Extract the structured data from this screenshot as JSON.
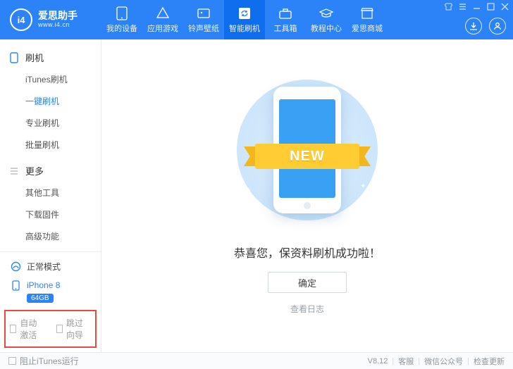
{
  "brand": {
    "mark": "i4",
    "zh": "爱思助手",
    "en": "www.i4.cn"
  },
  "nav": [
    {
      "label": "我的设备"
    },
    {
      "label": "应用游戏"
    },
    {
      "label": "铃声壁纸"
    },
    {
      "label": "智能刷机"
    },
    {
      "label": "工具箱"
    },
    {
      "label": "教程中心"
    },
    {
      "label": "爱思商城"
    }
  ],
  "sidebar": {
    "group1": {
      "title": "刷机"
    },
    "items1": [
      {
        "label": "iTunes刷机"
      },
      {
        "label": "一键刷机"
      },
      {
        "label": "专业刷机"
      },
      {
        "label": "批量刷机"
      }
    ],
    "group2": {
      "title": "更多"
    },
    "items2": [
      {
        "label": "其他工具"
      },
      {
        "label": "下载固件"
      },
      {
        "label": "高级功能"
      }
    ],
    "mode": "正常模式",
    "device": {
      "name": "iPhone 8",
      "storage": "64GB"
    },
    "autoActivate": "自动激活",
    "skipWizard": "跳过向导"
  },
  "content": {
    "ribbon": "NEW",
    "success": "恭喜您，保资料刷机成功啦！",
    "ok": "确定",
    "log": "查看日志"
  },
  "footer": {
    "blockItunes": "阻止iTunes运行",
    "version": "V8.12",
    "support": "客服",
    "wechat": "微信公众号",
    "update": "检查更新"
  }
}
